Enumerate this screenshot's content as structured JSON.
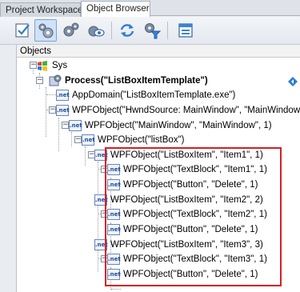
{
  "tabs": [
    {
      "label": "Project Workspace",
      "active": false
    },
    {
      "label": "Object Browser",
      "active": true
    }
  ],
  "toolbar": {
    "buttons": [
      {
        "icon": "checkbox-page-icon"
      },
      {
        "icon": "object-spy-gears-icon",
        "active": true
      },
      {
        "icon": "gears-icon"
      },
      {
        "icon": "view-eye-icon"
      },
      {
        "icon": "refresh-icon"
      },
      {
        "icon": "filter-gear-icon"
      },
      {
        "icon": "window-panel-icon"
      }
    ]
  },
  "panel": {
    "header": "Objects",
    "tree": [
      {
        "label": "Sys",
        "icon": "sys-windows-icon",
        "expanded": true
      },
      {
        "label": "Process(\"ListBoxItemTemplate\")",
        "icon": "process-icon",
        "bold": true,
        "expanded": true
      },
      {
        "label": "AppDomain(\"ListBoxItemTemplate.exe\")",
        "icon": "net-icon"
      },
      {
        "label": "WPFObject(\"HwndSource: MainWindow\", \"MainWindow\")",
        "icon": "net-icon",
        "expanded": true
      },
      {
        "label": "WPFObject(\"MainWindow\", \"MainWindow\", 1)",
        "icon": "net-icon",
        "expanded": true
      },
      {
        "label": "WPFObject(\"listBox\")",
        "icon": "net-icon",
        "expanded": true
      },
      {
        "label": "WPFObject(\"ListBoxItem\", \"Item1\", 1)",
        "icon": "net-icon",
        "expanded": true
      },
      {
        "label": "WPFObject(\"TextBlock\", \"Item1\", 1)",
        "icon": "net-icon"
      },
      {
        "label": "WPFObject(\"Button\", \"Delete\", 1)",
        "icon": "net-icon"
      },
      {
        "label": "WPFObject(\"ListBoxItem\", \"Item2\", 2)",
        "icon": "net-icon",
        "expanded": true
      },
      {
        "label": "WPFObject(\"TextBlock\", \"Item2\", 1)",
        "icon": "net-icon"
      },
      {
        "label": "WPFObject(\"Button\", \"Delete\", 1)",
        "icon": "net-icon"
      },
      {
        "label": "WPFObject(\"ListBoxItem\", \"Item3\", 3)",
        "icon": "net-icon",
        "expanded": true
      },
      {
        "label": "WPFObject(\"TextBlock\", \"Item3\", 1)",
        "icon": "net-icon"
      },
      {
        "label": "WPFObject(\"Button\", \"Delete\", 1)",
        "icon": "net-icon"
      }
    ],
    "net_icon_text": ".net",
    "collapse_glyph": "−"
  },
  "colors": {
    "highlight_border": "#d81e24",
    "selected_tool_bg": "#cfe2f7"
  }
}
